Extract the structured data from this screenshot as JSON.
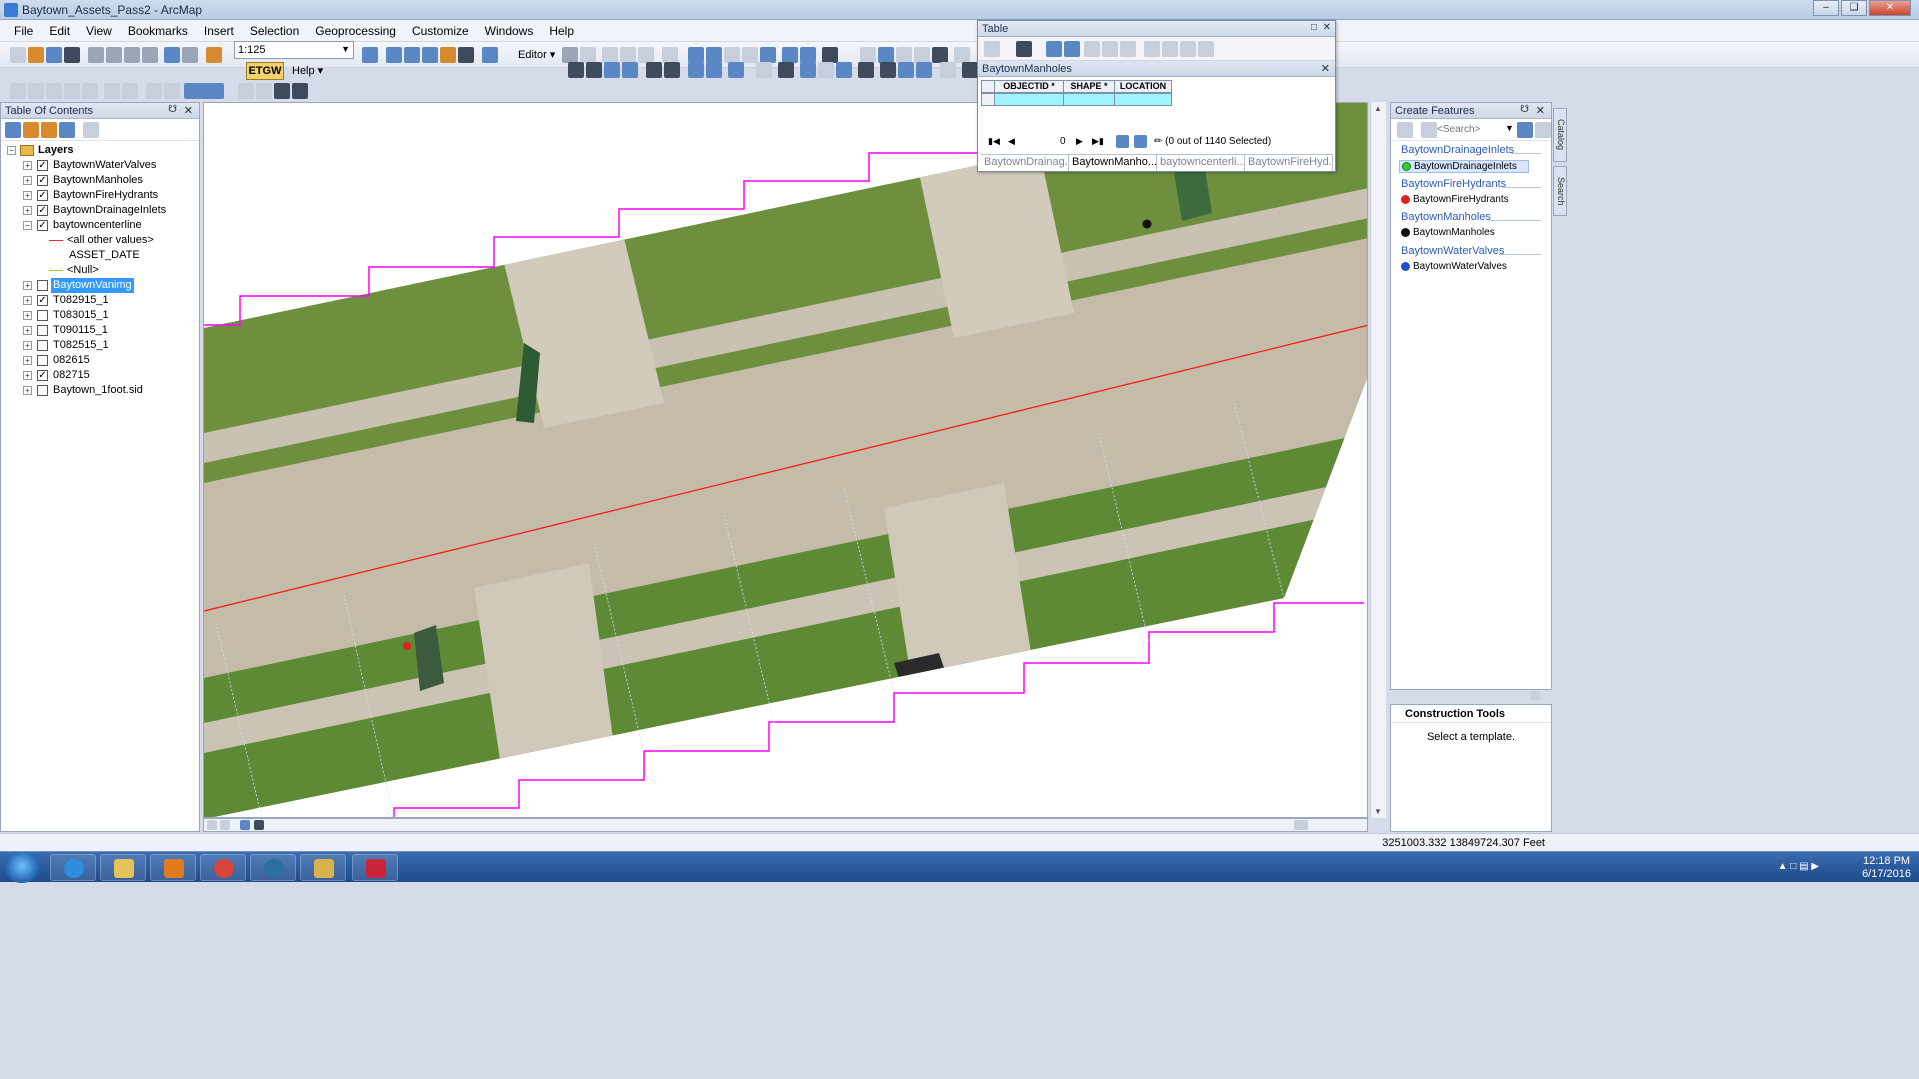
{
  "window": {
    "title": "Baytown_Assets_Pass2 - ArcMap"
  },
  "menu": [
    "File",
    "Edit",
    "View",
    "Bookmarks",
    "Insert",
    "Selection",
    "Geoprocessing",
    "Customize",
    "Windows",
    "Help"
  ],
  "toolbar": {
    "scale": "1:125",
    "editor_label": "Editor",
    "etgw_label": "ETGW",
    "help_label": "Help"
  },
  "toc": {
    "title": "Table Of Contents",
    "root": "Layers",
    "layers": [
      {
        "name": "BaytownWaterValves",
        "checked": true
      },
      {
        "name": "BaytownManholes",
        "checked": true
      },
      {
        "name": "BaytownFireHydrants",
        "checked": true
      },
      {
        "name": "BaytownDrainageInlets",
        "checked": true
      },
      {
        "name": "baytowncenterline",
        "checked": true,
        "expanded": true
      },
      {
        "name": "BaytownVanimg",
        "checked": false,
        "selected": true
      },
      {
        "name": "T082915_1",
        "checked": true
      },
      {
        "name": "T083015_1",
        "checked": false
      },
      {
        "name": "T090115_1",
        "checked": false
      },
      {
        "name": "T082515_1",
        "checked": false
      },
      {
        "name": "082615",
        "checked": false
      },
      {
        "name": "082715",
        "checked": true
      },
      {
        "name": "Baytown_1foot.sid",
        "checked": false
      }
    ],
    "centerline_legend": {
      "other": "<all other values>",
      "field": "ASSET_DATE",
      "null": "<Null>"
    }
  },
  "table": {
    "title": "Table",
    "subtitle": "BaytownManholes",
    "columns": [
      "OBJECTID *",
      "SHAPE *",
      "LOCATION"
    ],
    "record": "0",
    "selection_status": "(0 out of 1140 Selected)",
    "tabs": [
      "BaytownDrainag...",
      "BaytownManho...",
      "baytowncenterli...",
      "BaytownFireHyd..."
    ],
    "active_tab": 1
  },
  "create_features": {
    "title": "Create Features",
    "search_placeholder": "<Search>",
    "groups": [
      {
        "group": "BaytownDrainageInlets",
        "item": "BaytownDrainageInlets",
        "color": "#2fd02f",
        "selected": true
      },
      {
        "group": "BaytownFireHydrants",
        "item": "BaytownFireHydrants",
        "color": "#e02020"
      },
      {
        "group": "BaytownManholes",
        "item": "BaytownManholes",
        "color": "#111111"
      },
      {
        "group": "BaytownWaterValves",
        "item": "BaytownWaterValves",
        "color": "#1f4fd0"
      }
    ]
  },
  "construction_tools": {
    "title": "Construction Tools",
    "message": "Select a template."
  },
  "side_tabs": [
    "Catalog",
    "Search"
  ],
  "status": {
    "coordinates": "3251003.332  13849724.307 Feet"
  },
  "taskbar": {
    "time": "12:18 PM",
    "date": "6/17/2016"
  }
}
